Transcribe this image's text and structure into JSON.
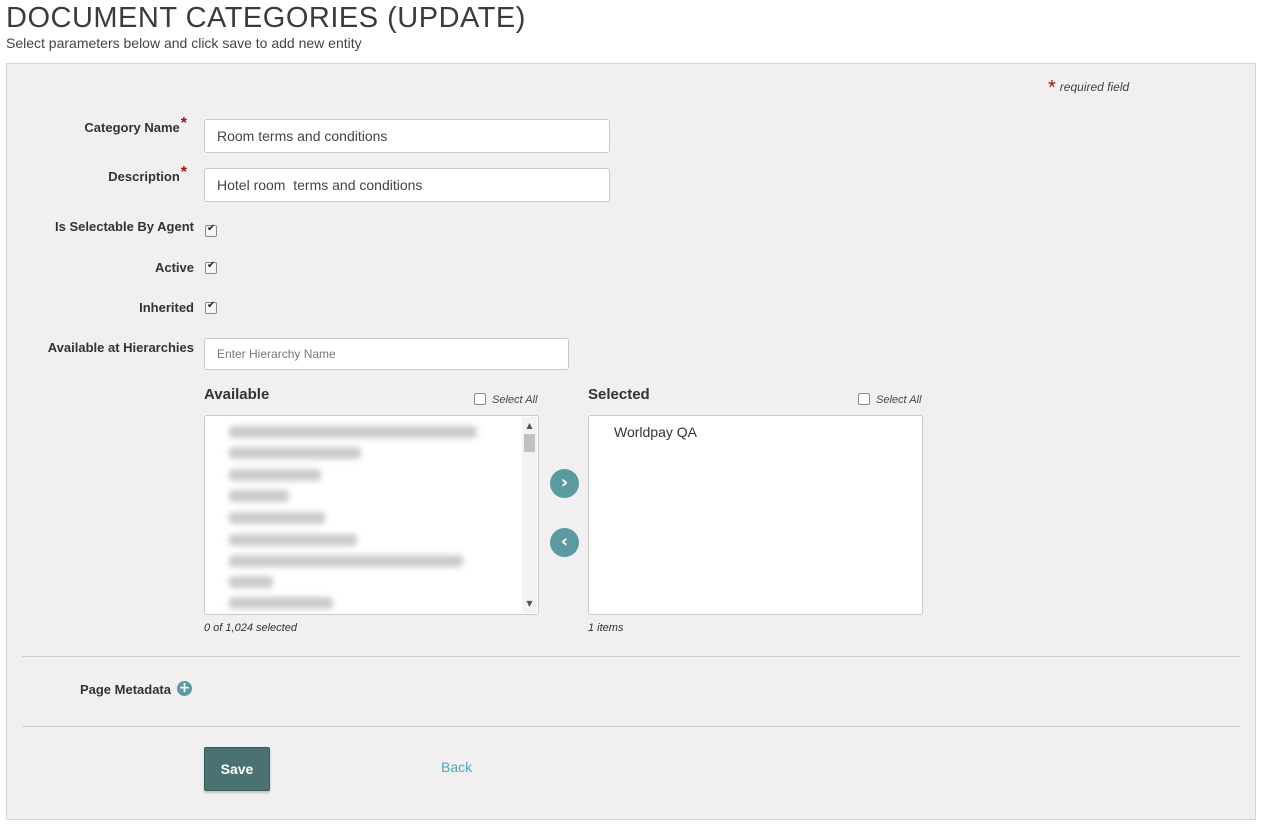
{
  "header": {
    "title": "DOCUMENT CATEGORIES (UPDATE)",
    "subtitle": "Select parameters below and click save to add new entity"
  },
  "form": {
    "required_marker": "*",
    "required_note": "required field",
    "category_name": {
      "label": "Category Name",
      "value": "Room terms and conditions"
    },
    "description": {
      "label": "Description",
      "value": "Hotel room  terms and conditions"
    },
    "is_selectable_by_agent": {
      "label": "Is Selectable By Agent",
      "checked": true
    },
    "active": {
      "label": "Active",
      "checked": true
    },
    "inherited": {
      "label": "Inherited",
      "checked": true
    },
    "hierarchies": {
      "label": "Available at Hierarchies",
      "placeholder": "Enter Hierarchy Name",
      "available": {
        "heading": "Available",
        "select_all": "Select All",
        "count_text": "0 of 1,024 selected"
      },
      "selected": {
        "heading": "Selected",
        "select_all": "Select All",
        "items": [
          "Worldpay QA"
        ],
        "count_text": "1 items"
      },
      "move_right_icon": "chevron-right-icon",
      "move_left_icon": "chevron-left-icon"
    },
    "page_metadata": {
      "label": "Page Metadata",
      "icon": "plus-circle-icon"
    }
  },
  "actions": {
    "save_label": "Save",
    "back_label": "Back"
  },
  "colors": {
    "accent": "#5b9aa0",
    "save_button": "#4a7272",
    "link": "#4aa8b5",
    "required": "#a0121a",
    "panel_bg": "#f1eff0"
  }
}
